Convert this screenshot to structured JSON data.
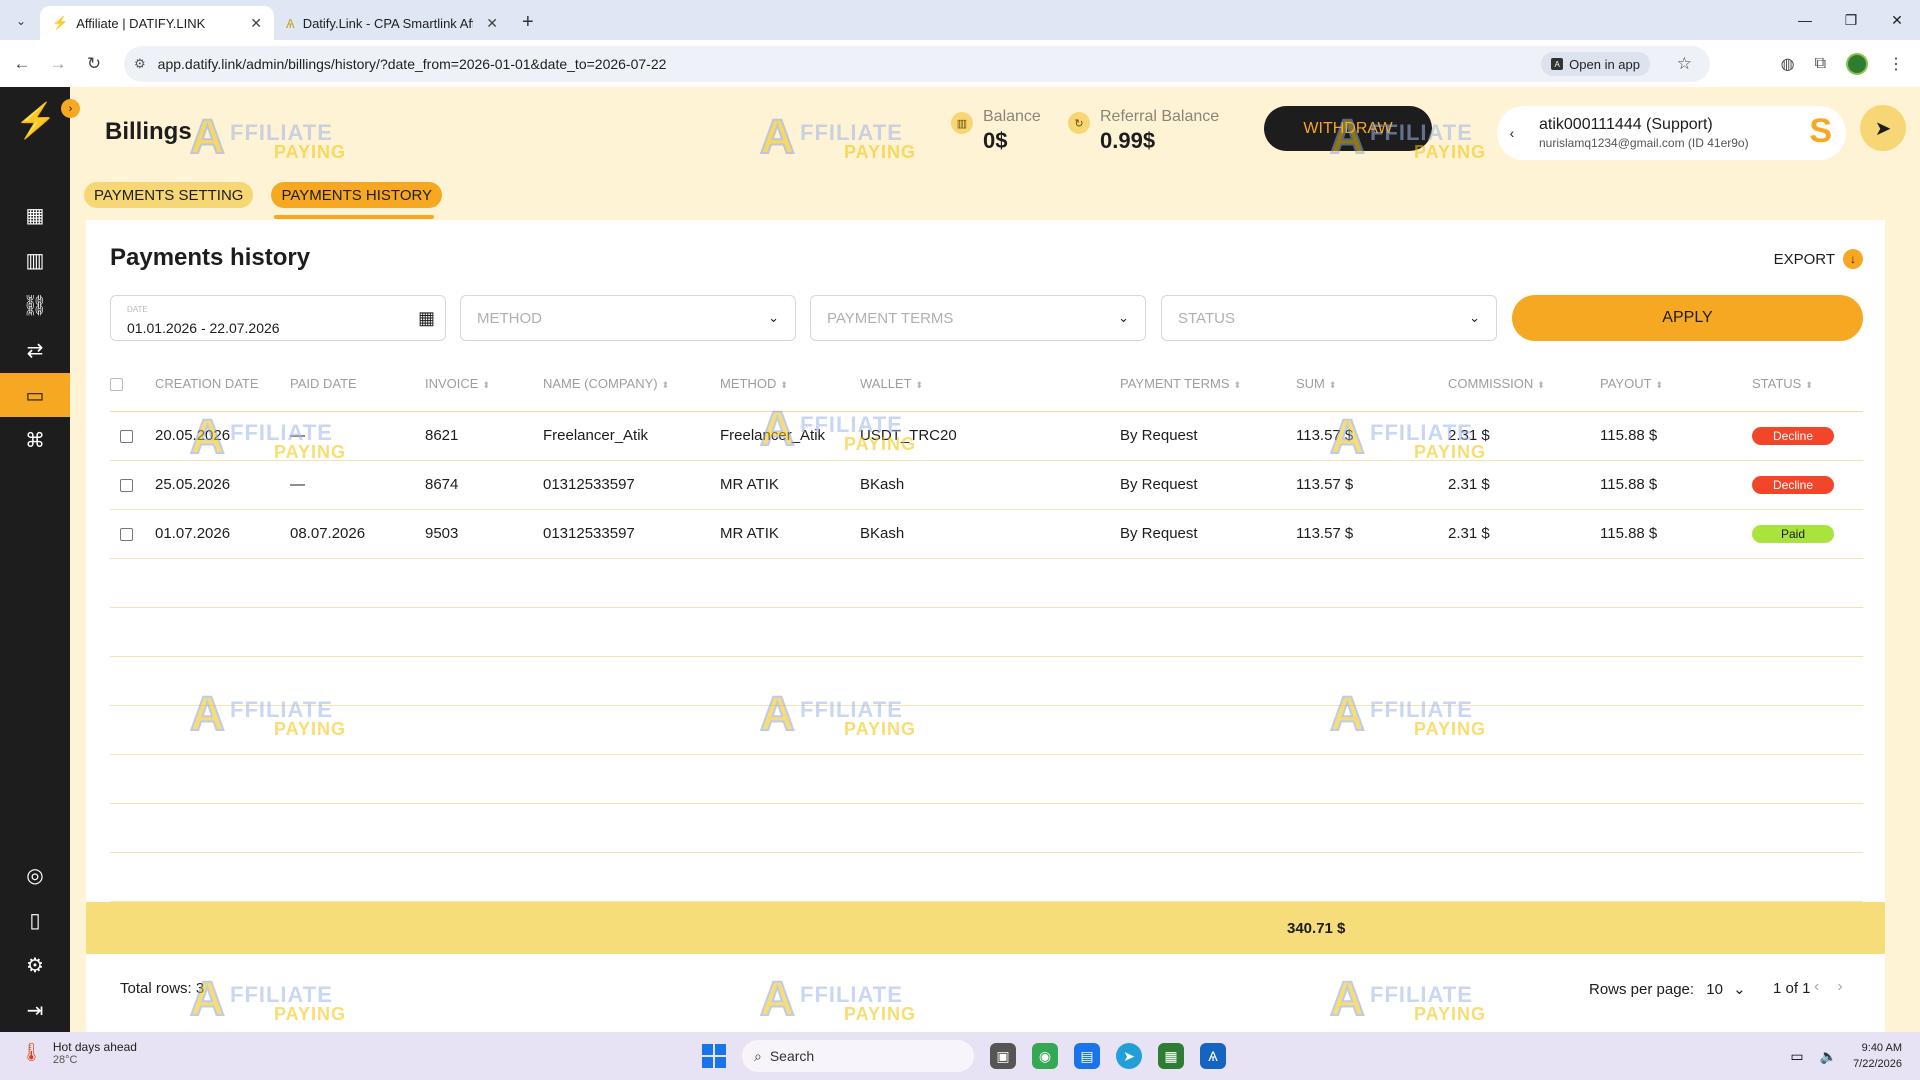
{
  "browser": {
    "tabs": [
      {
        "title": "Affiliate | DATIFY.LINK",
        "active": true
      },
      {
        "title": "Datify.Link - CPA Smartlink Affil",
        "active": false
      }
    ],
    "url": "app.datify.link/admin/billings/history/?date_from=2026-01-01&date_to=2026-07-22",
    "open_in_app": "Open in app"
  },
  "header": {
    "title": "Billings",
    "balance_label": "Balance",
    "balance_value": "0$",
    "referral_label": "Referral Balance",
    "referral_value": "0.99$",
    "withdraw_label": "WITHDRAW",
    "user_name": "atik000111444 (Support)",
    "user_email": "nurislamq1234@gmail.com (ID 41er9o)",
    "user_initial": "S"
  },
  "tabs": [
    {
      "label": "PAYMENTS SETTING",
      "active": false
    },
    {
      "label": "PAYMENTS HISTORY",
      "active": true
    }
  ],
  "card": {
    "title": "Payments history",
    "export_label": "EXPORT"
  },
  "filters": {
    "date_label": "DATE",
    "date_value": "01.01.2026 - 22.07.2026",
    "method_placeholder": "METHOD",
    "terms_placeholder": "PAYMENT TERMS",
    "status_placeholder": "STATUS",
    "apply_label": "APPLY"
  },
  "table": {
    "columns": [
      "CREATION DATE",
      "PAID DATE",
      "INVOICE",
      "NAME (COMPANY)",
      "METHOD",
      "WALLET",
      "PAYMENT TERMS",
      "SUM",
      "COMMISSION",
      "PAYOUT",
      "STATUS"
    ],
    "rows": [
      {
        "creation": "20.05.2026",
        "paid": "—",
        "invoice": "8621",
        "name": "Freelancer_Atik",
        "method": "Freelancer_Atik",
        "wallet": "USDT_TRC20",
        "terms": "By Request",
        "sum": "113.57 $",
        "commission": "2.31 $",
        "payout": "115.88 $",
        "status": "Decline"
      },
      {
        "creation": "25.05.2026",
        "paid": "—",
        "invoice": "8674",
        "name": "01312533597",
        "method": "MR ATIK",
        "wallet": "BKash",
        "terms": "By Request",
        "sum": "113.57 $",
        "commission": "2.31 $",
        "payout": "115.88 $",
        "status": "Decline"
      },
      {
        "creation": "01.07.2026",
        "paid": "08.07.2026",
        "invoice": "9503",
        "name": "01312533597",
        "method": "MR ATIK",
        "wallet": "BKash",
        "terms": "By Request",
        "sum": "113.57 $",
        "commission": "2.31 $",
        "payout": "115.88 $",
        "status": "Paid"
      }
    ],
    "total_sum": "340.71 $"
  },
  "footer": {
    "total_rows": "Total rows: 3",
    "rows_per_page_label": "Rows per page:",
    "rows_per_page_value": "10",
    "page_info": "1 of 1"
  },
  "watermark": {
    "a": "A",
    "top": "FFILIATE",
    "bottom": "PAYING"
  },
  "taskbar": {
    "weather_title": "Hot days ahead",
    "weather_temp": "28°C",
    "search_placeholder": "Search",
    "time": "9:40 AM",
    "date": "7/22/2026"
  },
  "colors": {
    "accent": "#f7a823",
    "sidebar": "#1d1d1d",
    "background": "#fff3d6",
    "decline": "#f2462b",
    "paid": "#a8e33e"
  }
}
